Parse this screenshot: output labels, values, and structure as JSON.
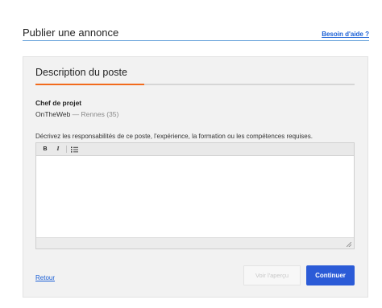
{
  "header": {
    "title": "Publier une annonce",
    "help_link": "Besoin d'aide ?"
  },
  "section": {
    "title": "Description du poste",
    "progress": 0.34,
    "progress_color": "#f26b1d"
  },
  "job": {
    "title": "Chef de projet",
    "company": "OnTheWeb",
    "location": " — Rennes (35)"
  },
  "editor": {
    "instructions": "Décrivez les responsabilités de ce poste, l'expérience, la formation ou les compétences requises.",
    "toolbar": {
      "bold": "B",
      "italic": "I",
      "list_icon": "bulleted-list-icon"
    },
    "value": ""
  },
  "actions": {
    "back": "Retour",
    "preview": "Voir l'aperçu",
    "continue": "Continuer",
    "accent_color": "#2b5bd7"
  }
}
